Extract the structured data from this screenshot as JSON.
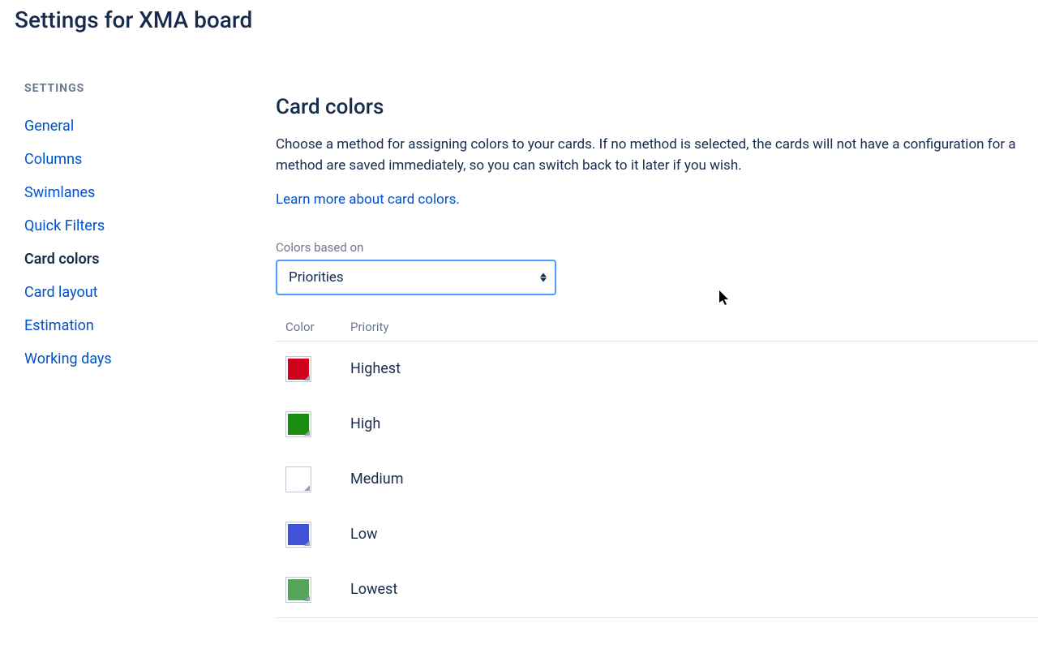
{
  "page": {
    "title": "Settings for XMA board"
  },
  "sidebar": {
    "heading": "SETTINGS",
    "items": [
      {
        "label": "General",
        "active": false
      },
      {
        "label": "Columns",
        "active": false
      },
      {
        "label": "Swimlanes",
        "active": false
      },
      {
        "label": "Quick Filters",
        "active": false
      },
      {
        "label": "Card colors",
        "active": true
      },
      {
        "label": "Card layout",
        "active": false
      },
      {
        "label": "Estimation",
        "active": false
      },
      {
        "label": "Working days",
        "active": false
      }
    ]
  },
  "main": {
    "title": "Card colors",
    "description": "Choose a method for assigning colors to your cards. If no method is selected, the cards will not have a configuration for a method are saved immediately, so you can switch back to it later if you wish.",
    "learnMore": "Learn more about card colors.",
    "selectLabel": "Colors based on",
    "selectValue": "Priorities",
    "columns": {
      "color": "Color",
      "priority": "Priority"
    },
    "rows": [
      {
        "name": "Highest",
        "color": "#d0021b"
      },
      {
        "name": "High",
        "color": "#1a8c0f"
      },
      {
        "name": "Medium",
        "color": "#ffffff"
      },
      {
        "name": "Low",
        "color": "#4052d6"
      },
      {
        "name": "Lowest",
        "color": "#57a55a"
      }
    ]
  }
}
